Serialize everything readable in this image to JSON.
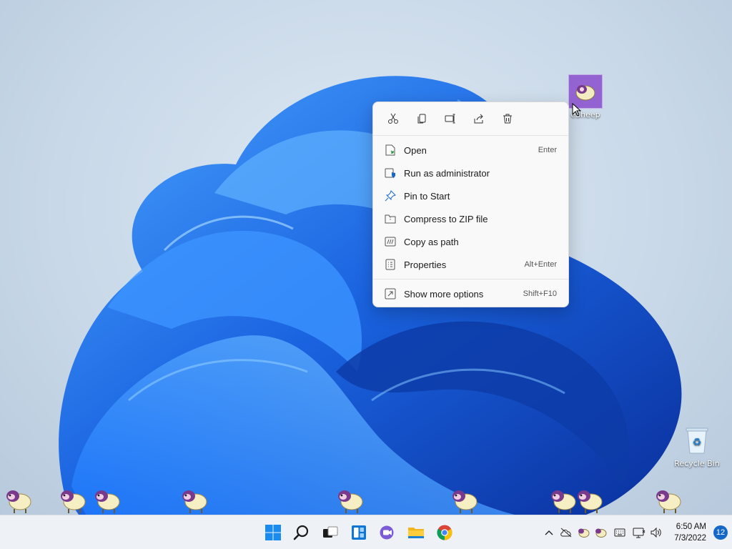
{
  "desktop": {
    "icons": [
      {
        "label": "eSheep",
        "icon": "sheep-icon"
      },
      {
        "label": "Recycle Bin",
        "icon": "recycle-bin-icon"
      }
    ]
  },
  "context_menu": {
    "quick_actions": [
      {
        "name": "cut",
        "icon": "scissors-icon"
      },
      {
        "name": "copy",
        "icon": "copy-icon"
      },
      {
        "name": "rename",
        "icon": "rename-icon"
      },
      {
        "name": "share",
        "icon": "share-icon"
      },
      {
        "name": "delete",
        "icon": "trash-icon"
      }
    ],
    "items": [
      {
        "label": "Open",
        "shortcut": "Enter",
        "icon": "open-file-icon"
      },
      {
        "label": "Run as administrator",
        "shortcut": "",
        "icon": "shield-icon"
      },
      {
        "label": "Pin to Start",
        "shortcut": "",
        "icon": "pin-icon"
      },
      {
        "label": "Compress to ZIP file",
        "shortcut": "",
        "icon": "zip-folder-icon"
      },
      {
        "label": "Copy as path",
        "shortcut": "",
        "icon": "copy-path-icon"
      },
      {
        "label": "Properties",
        "shortcut": "Alt+Enter",
        "icon": "properties-icon"
      }
    ],
    "more": {
      "label": "Show more options",
      "shortcut": "Shift+F10",
      "icon": "more-options-icon"
    }
  },
  "taskbar": {
    "apps": [
      {
        "name": "start",
        "icon": "windows-logo-icon"
      },
      {
        "name": "search",
        "icon": "search-icon"
      },
      {
        "name": "task-view",
        "icon": "task-view-icon"
      },
      {
        "name": "widgets",
        "icon": "widgets-icon"
      },
      {
        "name": "chat",
        "icon": "chat-icon"
      },
      {
        "name": "file-explorer",
        "icon": "folder-icon"
      },
      {
        "name": "chrome",
        "icon": "chrome-icon"
      }
    ],
    "tray": {
      "icons": [
        "chevron-up-icon",
        "cloud-off-icon",
        "sheep-icon",
        "sheep-icon",
        "keyboard-icon",
        "network-icon",
        "volume-icon"
      ],
      "time": "6:50 AM",
      "date": "7/3/2022",
      "notifications": "12"
    }
  },
  "colors": {
    "accent": "#1668c8",
    "menu_bg": "#f9f9f9",
    "taskbar_bg": "#eef2f6"
  }
}
